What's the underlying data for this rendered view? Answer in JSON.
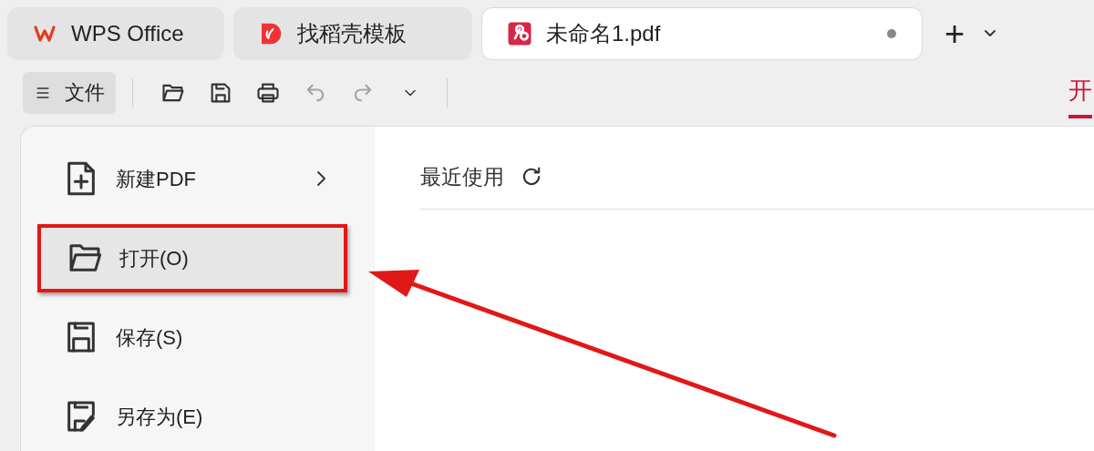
{
  "tabs": [
    {
      "kind": "home",
      "label": "WPS Office",
      "selected": false,
      "modified": false
    },
    {
      "kind": "template",
      "label": "找稻壳模板",
      "selected": false,
      "modified": false
    },
    {
      "kind": "pdf",
      "label": "未命名1.pdf",
      "selected": true,
      "modified": true
    }
  ],
  "new_tab": {
    "plus": "+"
  },
  "toolbar": {
    "file_button": "文件",
    "tools": [
      {
        "kind": "open",
        "disabled": false
      },
      {
        "kind": "save",
        "disabled": false
      },
      {
        "kind": "print",
        "disabled": false
      },
      {
        "kind": "undo",
        "disabled": true
      },
      {
        "kind": "redo",
        "disabled": true
      },
      {
        "kind": "more",
        "disabled": false
      }
    ]
  },
  "ribbon_tabs": [
    {
      "label": "开",
      "selected": true
    }
  ],
  "file_menu": {
    "items": [
      {
        "kind": "new",
        "label": "新建PDF",
        "submenu": true,
        "selected": false,
        "annotated": false
      },
      {
        "kind": "open",
        "label": "打开(O)",
        "submenu": false,
        "selected": true,
        "annotated": true
      },
      {
        "kind": "save",
        "label": "保存(S)",
        "submenu": false,
        "selected": false,
        "annotated": false
      },
      {
        "kind": "saveas",
        "label": "另存为(E)",
        "submenu": false,
        "selected": false,
        "annotated": false
      }
    ]
  },
  "recent": {
    "title": "最近使用"
  },
  "annotation_arrow": true
}
